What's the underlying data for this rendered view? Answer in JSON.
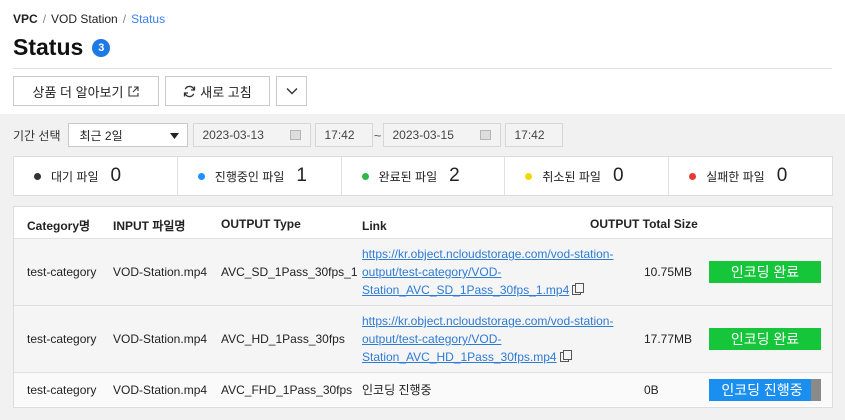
{
  "breadcrumb": {
    "items": [
      "VPC",
      "VOD Station"
    ],
    "current": "Status"
  },
  "page": {
    "title": "Status",
    "badge": "3"
  },
  "toolbar": {
    "learn_more": "상품 더 알아보기",
    "refresh": "새로 고침"
  },
  "period": {
    "label": "기간 선택",
    "range_selected": "최근 2일",
    "start_date": "2023-03-13",
    "start_time": "17:42",
    "separator": "~",
    "end_date": "2023-03-15",
    "end_time": "17:42"
  },
  "summary": [
    {
      "label": "대기 파일",
      "count": "0",
      "color": "#333333"
    },
    {
      "label": "진행중인 파일",
      "count": "1",
      "color": "#1e90ff"
    },
    {
      "label": "완료된 파일",
      "count": "2",
      "color": "#2db84b"
    },
    {
      "label": "취소된 파일",
      "count": "0",
      "color": "#f5d800"
    },
    {
      "label": "실패한 파일",
      "count": "0",
      "color": "#e53935"
    }
  ],
  "table": {
    "headers": {
      "category": "Category명",
      "input": "INPUT 파일명",
      "output_type": "OUTPUT Type",
      "link": "Link",
      "total_size": "OUTPUT Total Size"
    },
    "rows": [
      {
        "category": "test-category",
        "input": "VOD-Station.mp4",
        "output_type": "AVC_SD_1Pass_30fps_1",
        "link_lines": [
          "https://kr.object.ncloudstorage.com/vod-station-",
          "output/test-category/VOD-",
          "Station_AVC_SD_1Pass_30fps_1.mp4"
        ],
        "size": "10.75MB",
        "status": "인코딩 완료"
      },
      {
        "category": "test-category",
        "input": "VOD-Station.mp4",
        "output_type": "AVC_HD_1Pass_30fps",
        "link_lines": [
          "https://kr.object.ncloudstorage.com/vod-station-",
          "output/test-category/VOD-",
          "Station_AVC_HD_1Pass_30fps.mp4"
        ],
        "size": "17.77MB",
        "status": "인코딩 완료"
      },
      {
        "category": "test-category",
        "input": "VOD-Station.mp4",
        "output_type": "AVC_FHD_1Pass_30fps",
        "link_text": "인코딩 진행중",
        "size": "0B",
        "status": "인코딩 진행중"
      }
    ]
  },
  "colors": {
    "accent": "#1e78e6",
    "link": "#2e7bd6",
    "done": "#15c53a",
    "progress": "#1a8ff0"
  }
}
